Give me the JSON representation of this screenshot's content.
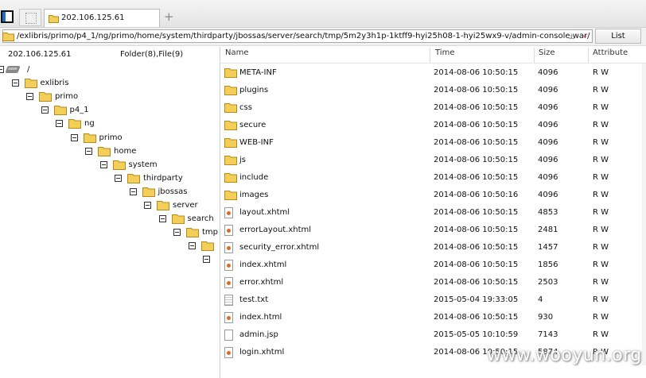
{
  "tabbar": {
    "active_tab_title": "202.106.125.61",
    "new_tab_symbol": "+"
  },
  "address": {
    "path": "/exlibris/primo/p4_1/ng/primo/home/system/thirdparty/jbossas/server/search/tmp/5m2y3h1p-1ktff9-hyi25h08-1-hyi25wx9-v/admin-console.war/",
    "plusminus": "±",
    "chevron": "⌄",
    "list_button": "List"
  },
  "left_panel": {
    "host": "202.106.125.61",
    "counts": "Folder(8),File(9)"
  },
  "tree": [
    {
      "label": "/",
      "type": "drive"
    },
    {
      "label": "exlibris",
      "type": "folder"
    },
    {
      "label": "primo",
      "type": "folder"
    },
    {
      "label": "p4_1",
      "type": "folder"
    },
    {
      "label": "ng",
      "type": "folder"
    },
    {
      "label": "primo",
      "type": "folder"
    },
    {
      "label": "home",
      "type": "folder"
    },
    {
      "label": "system",
      "type": "folder"
    },
    {
      "label": "thirdparty",
      "type": "folder"
    },
    {
      "label": "jbossas",
      "type": "folder"
    },
    {
      "label": "server",
      "type": "folder"
    },
    {
      "label": "search",
      "type": "folder"
    },
    {
      "label": "tmp",
      "type": "folder"
    },
    {
      "label": "",
      "type": "folder"
    },
    {
      "label": "",
      "type": "none"
    }
  ],
  "columns": {
    "name": "Name",
    "time": "Time",
    "size": "Size",
    "attribute": "Attribute"
  },
  "files": [
    {
      "name": "META-INF",
      "time": "2014-08-06 10:50:15",
      "size": "4096",
      "attr": "R W",
      "icon": "folder-icon"
    },
    {
      "name": "plugins",
      "time": "2014-08-06 10:50:15",
      "size": "4096",
      "attr": "R W",
      "icon": "folder-icon"
    },
    {
      "name": "css",
      "time": "2014-08-06 10:50:15",
      "size": "4096",
      "attr": "R W",
      "icon": "folder-icon"
    },
    {
      "name": "secure",
      "time": "2014-08-06 10:50:15",
      "size": "4096",
      "attr": "R W",
      "icon": "folder-icon"
    },
    {
      "name": "WEB-INF",
      "time": "2014-08-06 10:50:15",
      "size": "4096",
      "attr": "R W",
      "icon": "folder-icon"
    },
    {
      "name": "js",
      "time": "2014-08-06 10:50:15",
      "size": "4096",
      "attr": "R W",
      "icon": "folder-icon"
    },
    {
      "name": "include",
      "time": "2014-08-06 10:50:15",
      "size": "4096",
      "attr": "R W",
      "icon": "folder-icon"
    },
    {
      "name": "images",
      "time": "2014-08-06 10:50:16",
      "size": "4096",
      "attr": "R W",
      "icon": "folder-icon"
    },
    {
      "name": "layout.xhtml",
      "time": "2014-08-06 10:50:15",
      "size": "4853",
      "attr": "R W",
      "icon": "web-file-icon"
    },
    {
      "name": "errorLayout.xhtml",
      "time": "2014-08-06 10:50:15",
      "size": "2481",
      "attr": "R W",
      "icon": "web-file-icon"
    },
    {
      "name": "security_error.xhtml",
      "time": "2014-08-06 10:50:15",
      "size": "1457",
      "attr": "R W",
      "icon": "web-file-icon"
    },
    {
      "name": "index.xhtml",
      "time": "2014-08-06 10:50:15",
      "size": "1856",
      "attr": "R W",
      "icon": "web-file-icon"
    },
    {
      "name": "error.xhtml",
      "time": "2014-08-06 10:50:15",
      "size": "2503",
      "attr": "R W",
      "icon": "web-file-icon"
    },
    {
      "name": "test.txt",
      "time": "2015-05-04 19:33:05",
      "size": "4",
      "attr": "R W",
      "icon": "text-file-icon"
    },
    {
      "name": "index.html",
      "time": "2014-08-06 10:50:15",
      "size": "930",
      "attr": "R W",
      "icon": "web-file-icon"
    },
    {
      "name": "admin.jsp",
      "time": "2015-05-05 10:10:59",
      "size": "7143",
      "attr": "R W",
      "icon": "blank-file-icon"
    },
    {
      "name": "login.xhtml",
      "time": "2014-08-06 10:50:15",
      "size": "5874",
      "attr": "R W",
      "icon": "web-file-icon"
    }
  ],
  "watermark": "www.wooyun.org",
  "colors": {
    "folder": "#f3cf5a",
    "accent": "#1e6fc8",
    "chevron": "#d12f2f"
  }
}
